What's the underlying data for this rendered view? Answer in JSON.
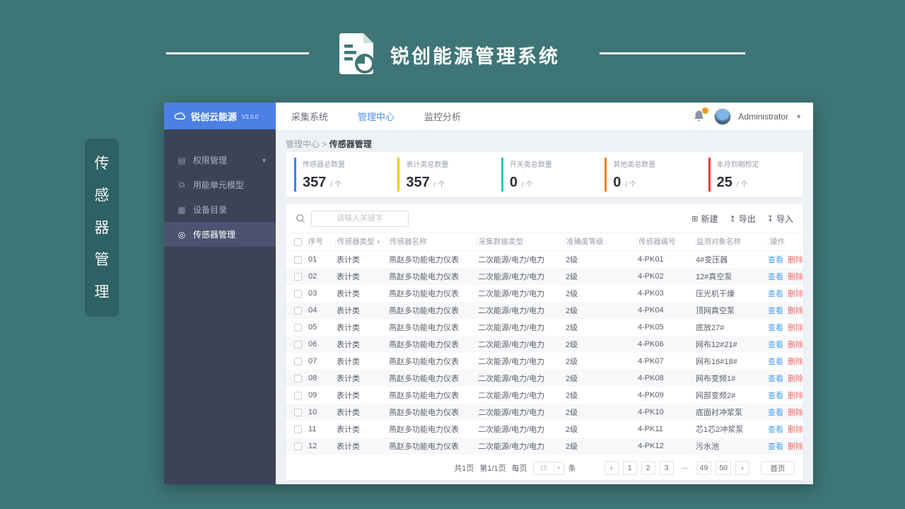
{
  "page": {
    "brand_title": "锐创能源管理系统",
    "side_label": "传感器管理"
  },
  "sidebar": {
    "logo": "锐创云能源",
    "version": "V2.0.0",
    "items": [
      {
        "label": "权限管理",
        "icon": "permission-icon",
        "glyph": "▤",
        "expandable": true,
        "active": false
      },
      {
        "label": "用能单元模型",
        "icon": "energy-unit-model-icon",
        "glyph": "⧉",
        "expandable": false,
        "active": false
      },
      {
        "label": "设备目录",
        "icon": "device-catalog-icon",
        "glyph": "▦",
        "expandable": false,
        "active": false
      },
      {
        "label": "传感器管理",
        "icon": "sensor-management-icon",
        "glyph": "◎",
        "expandable": false,
        "active": true
      }
    ]
  },
  "topnav": {
    "tabs": [
      {
        "label": "采集系统",
        "active": false
      },
      {
        "label": "管理中心",
        "active": true
      },
      {
        "label": "监控分析",
        "active": false
      }
    ],
    "user": "Administrator"
  },
  "breadcrumb": {
    "parent": "管理中心",
    "separator": ">",
    "current": "传感器管理"
  },
  "stats": [
    {
      "label": "传感器总数量",
      "value": "357",
      "unit": "/ 个",
      "color": "#3d7ff0"
    },
    {
      "label": "表计类总数量",
      "value": "357",
      "unit": "/ 个",
      "color": "#f2c81f"
    },
    {
      "label": "开关类总数量",
      "value": "0",
      "unit": "/ 个",
      "color": "#29c3c5"
    },
    {
      "label": "其他类总数量",
      "value": "0",
      "unit": "/ 个",
      "color": "#e0862a"
    },
    {
      "label": "本月到期检定",
      "value": "25",
      "unit": "/ 个",
      "color": "#e23a3a"
    }
  ],
  "toolbar": {
    "search_placeholder": "请输入关键字",
    "buttons": [
      {
        "label": "新建",
        "icon": "new-icon"
      },
      {
        "label": "导出",
        "icon": "export-icon"
      },
      {
        "label": "导入",
        "icon": "import-icon"
      }
    ]
  },
  "table": {
    "headers": [
      "序号",
      "传感器类型",
      "传感器名称",
      "采集数据类型",
      "准确度等级",
      "传感器编号",
      "监测对象名称",
      "操作"
    ],
    "view_label": "查看",
    "delete_label": "删除",
    "rows": [
      {
        "no": "01",
        "type": "表计类",
        "name": "燕赵多功能电力仪表",
        "data_type": "二次能源/电力/电力",
        "accuracy": "2级",
        "code": "4-PK01",
        "target": "4#变压器"
      },
      {
        "no": "02",
        "type": "表计类",
        "name": "燕赵多功能电力仪表",
        "data_type": "二次能源/电力/电力",
        "accuracy": "2级",
        "code": "4-PK02",
        "target": "12#真空泵"
      },
      {
        "no": "03",
        "type": "表计类",
        "name": "燕赵多功能电力仪表",
        "data_type": "二次能源/电力/电力",
        "accuracy": "2级",
        "code": "4-PK03",
        "target": "压光机干燥"
      },
      {
        "no": "04",
        "type": "表计类",
        "name": "燕赵多功能电力仪表",
        "data_type": "二次能源/电力/电力",
        "accuracy": "2级",
        "code": "4-PK04",
        "target": "顶网真空泵"
      },
      {
        "no": "05",
        "type": "表计类",
        "name": "燕赵多功能电力仪表",
        "data_type": "二次能源/电力/电力",
        "accuracy": "2级",
        "code": "4-PK05",
        "target": "底放27#"
      },
      {
        "no": "06",
        "type": "表计类",
        "name": "燕赵多功能电力仪表",
        "data_type": "二次能源/电力/电力",
        "accuracy": "2级",
        "code": "4-PK06",
        "target": "网布12#21#"
      },
      {
        "no": "07",
        "type": "表计类",
        "name": "燕赵多功能电力仪表",
        "data_type": "二次能源/电力/电力",
        "accuracy": "2级",
        "code": "4-PK07",
        "target": "网布16#18#"
      },
      {
        "no": "08",
        "type": "表计类",
        "name": "燕赵多功能电力仪表",
        "data_type": "二次能源/电力/电力",
        "accuracy": "2级",
        "code": "4-PK08",
        "target": "网布变频1#"
      },
      {
        "no": "09",
        "type": "表计类",
        "name": "燕赵多功能电力仪表",
        "data_type": "二次能源/电力/电力",
        "accuracy": "2级",
        "code": "4-PK09",
        "target": "网部变频2#"
      },
      {
        "no": "10",
        "type": "表计类",
        "name": "燕赵多功能电力仪表",
        "data_type": "二次能源/电力/电力",
        "accuracy": "2级",
        "code": "4-PK10",
        "target": "底面衬冲浆泵"
      },
      {
        "no": "11",
        "type": "表计类",
        "name": "燕赵多功能电力仪表",
        "data_type": "二次能源/电力/电力",
        "accuracy": "2级",
        "code": "4-PK11",
        "target": "芯1芯2冲浆泵"
      },
      {
        "no": "12",
        "type": "表计类",
        "name": "燕赵多功能电力仪表",
        "data_type": "二次能源/电力/电力",
        "accuracy": "2级",
        "code": "4-PK12",
        "target": "污水池"
      }
    ]
  },
  "pagination": {
    "total_pages_text": "共1页",
    "current_page_text": "第1/1页",
    "per_page_label": "每页",
    "per_page_value": "15",
    "unit_label": "条",
    "prev": "‹",
    "next": "›",
    "pages": [
      "1",
      "2",
      "3",
      "—",
      "49",
      "50"
    ],
    "first_label": "首页"
  }
}
